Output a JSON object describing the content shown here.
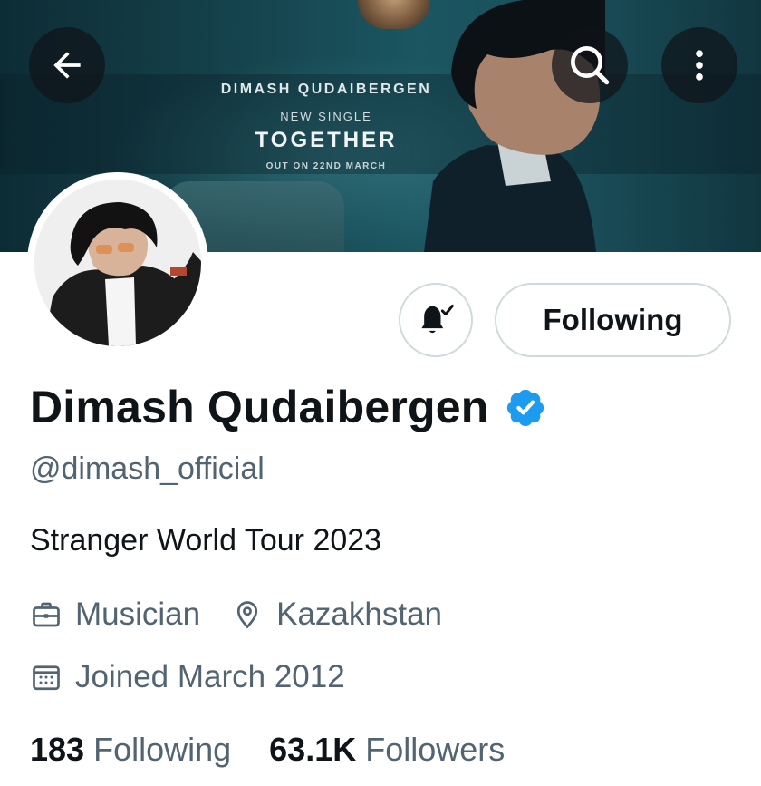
{
  "banner": {
    "line1": "DIMASH QUDAIBERGEN",
    "line2": "NEW SINGLE",
    "line3": "TOGETHER",
    "line4": "OUT ON 22ND MARCH"
  },
  "header": {
    "back_icon": "arrow-left-icon",
    "search_icon": "search-icon",
    "more_icon": "more-vertical-icon"
  },
  "actions": {
    "notification_icon": "bell-checked-icon",
    "following_label": "Following"
  },
  "profile": {
    "display_name": "Dimash Qudaibergen",
    "verified": true,
    "verified_color": "#1d9bf0",
    "handle": "@dimash_official",
    "bio": "Stranger World Tour 2023",
    "profession": "Musician",
    "location": "Kazakhstan",
    "joined": "Joined March 2012"
  },
  "stats": {
    "following_count": "183",
    "following_label": "Following",
    "followers_count": "63.1K",
    "followers_label": "Followers"
  },
  "colors": {
    "text_primary": "#0f1419",
    "text_secondary": "#536471",
    "border": "#cfd9de"
  }
}
